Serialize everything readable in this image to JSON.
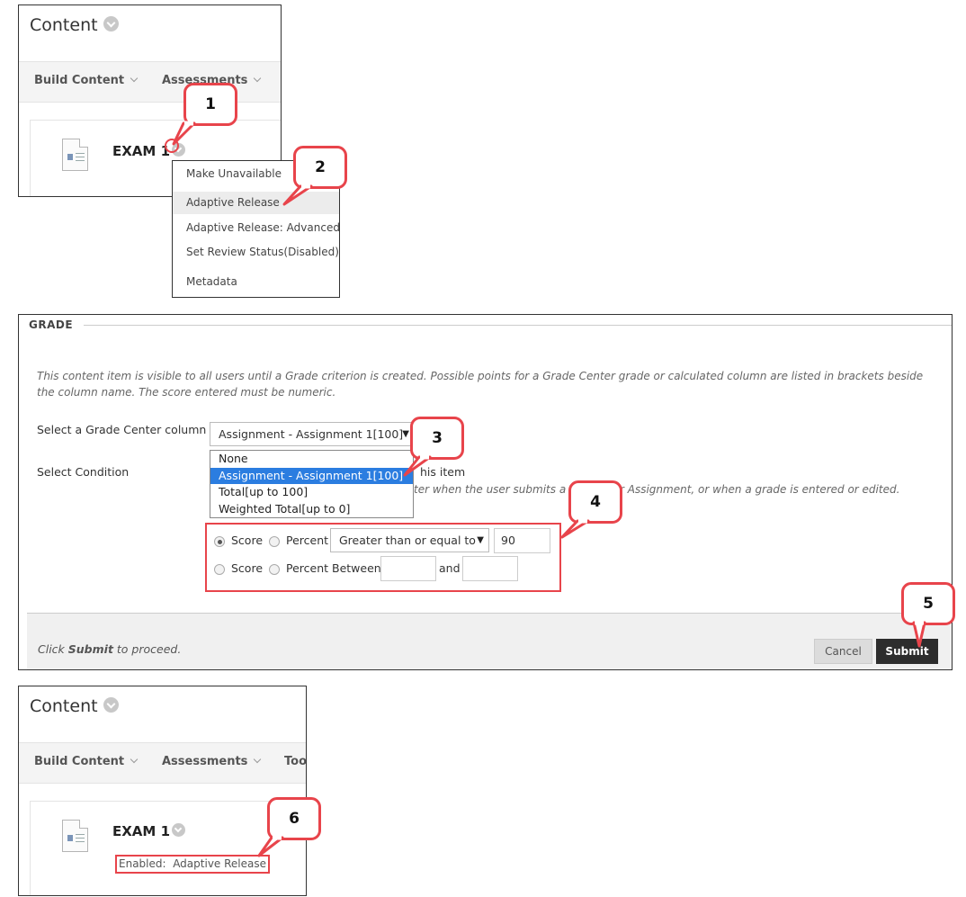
{
  "panel1": {
    "title": "Content",
    "toolbar": [
      "Build Content",
      "Assessments"
    ],
    "item_title": "EXAM 1"
  },
  "context_menu": {
    "items": [
      "Make Unavailable",
      "Adaptive Release",
      "Adaptive Release: Advanced",
      "Set Review Status(Disabled)",
      "Metadata"
    ],
    "highlighted": "Adaptive Release"
  },
  "callouts": [
    "1",
    "2",
    "3",
    "4",
    "5",
    "6"
  ],
  "grade": {
    "section_label": "GRADE",
    "help_text": "This content item is visible to all users until a Grade criterion is created. Possible points for a Grade Center grade or calculated column are listed in brackets beside the column name. The score entered must be numeric.",
    "column_label": "Select a Grade Center column",
    "column_selected": "Assignment - Assignment 1[100]",
    "dropdown_options": [
      "None",
      "Assignment - Assignment 1[100]",
      "Total[up to 100]",
      "Weighted Total[up to 0]"
    ],
    "condition_label": "Select Condition",
    "condition_text_1": "his item",
    "condition_text_2": "ter when the user submits a Tes",
    "condition_text_3": "r Assignment, or when a grade is entered or edited.",
    "row1": {
      "score_label": "Score",
      "percent_label": "Percent",
      "operator": "Greater than or equal to",
      "value": "90",
      "score_selected": true
    },
    "row2": {
      "score_label": "Score",
      "percent_between_label": "Percent Between",
      "and_label": "and",
      "from_value": "",
      "to_value": ""
    },
    "footer": {
      "click_text": "Click",
      "submit_word": "Submit",
      "proceed_text": "to proceed.",
      "cancel_label": "Cancel",
      "submit_label": "Submit"
    }
  },
  "panel3": {
    "title": "Content",
    "toolbar": [
      "Build Content",
      "Assessments",
      "Too"
    ],
    "item_title": "EXAM 1",
    "enabled_label": "Enabled:",
    "enabled_value": "Adaptive Release"
  },
  "colors": {
    "callout_border": "#e8444b",
    "dropdown_selected": "#2b7de0",
    "submit_button": "#2d2d2d"
  },
  "icons": [
    "chevron-down-icon",
    "document-icon",
    "dropdown-arrow-icon",
    "radio-icon"
  ]
}
